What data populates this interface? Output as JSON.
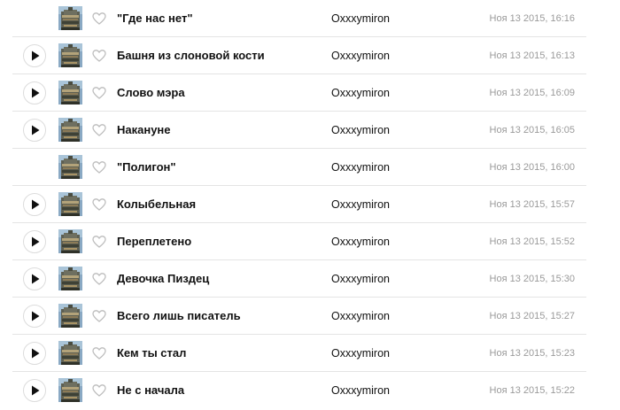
{
  "icons": {
    "play": "play-icon",
    "like": "heart-outline-icon",
    "cover": "album-cover-image"
  },
  "colors": {
    "text": "#111111",
    "date": "#9a9a9a",
    "divider": "#e4e4e4",
    "icon": "#bdbdbd"
  },
  "tracks": [
    {
      "title": "\"Где нас нет\"",
      "artist": "Oxxxymiron",
      "date": "Ноя 13 2015, 16:16",
      "has_play": false
    },
    {
      "title": "Башня из слоновой кости",
      "artist": "Oxxxymiron",
      "date": "Ноя 13 2015, 16:13",
      "has_play": true
    },
    {
      "title": "Слово мэра",
      "artist": "Oxxxymiron",
      "date": "Ноя 13 2015, 16:09",
      "has_play": true
    },
    {
      "title": "Накануне",
      "artist": "Oxxxymiron",
      "date": "Ноя 13 2015, 16:05",
      "has_play": true
    },
    {
      "title": "\"Полигон\"",
      "artist": "Oxxxymiron",
      "date": "Ноя 13 2015, 16:00",
      "has_play": false
    },
    {
      "title": "Колыбельная",
      "artist": "Oxxxymiron",
      "date": "Ноя 13 2015, 15:57",
      "has_play": true
    },
    {
      "title": "Переплетено",
      "artist": "Oxxxymiron",
      "date": "Ноя 13 2015, 15:52",
      "has_play": true
    },
    {
      "title": "Девочка Пиздец",
      "artist": "Oxxxymiron",
      "date": "Ноя 13 2015, 15:30",
      "has_play": true
    },
    {
      "title": "Всего лишь писатель",
      "artist": "Oxxxymiron",
      "date": "Ноя 13 2015, 15:27",
      "has_play": true
    },
    {
      "title": "Кем ты стал",
      "artist": "Oxxxymiron",
      "date": "Ноя 13 2015, 15:23",
      "has_play": true
    },
    {
      "title": "Не с начала",
      "artist": "Oxxxymiron",
      "date": "Ноя 13 2015, 15:22",
      "has_play": true
    }
  ]
}
